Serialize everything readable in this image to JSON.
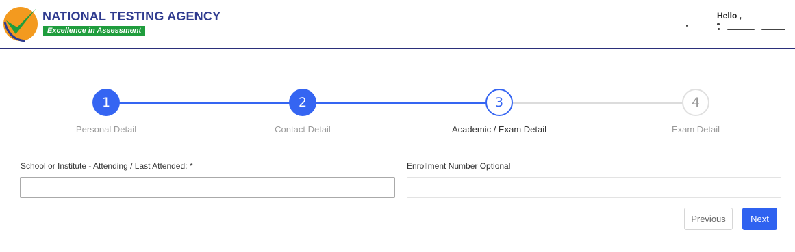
{
  "header": {
    "brand_title": "NATIONAL TESTING AGENCY",
    "brand_tagline": "Excellence in Assessment",
    "greeting": "Hello ,",
    "logo_icon": "nta-logo-checkmark-icon",
    "colors": {
      "brand_blue": "#2f3b8f",
      "brand_green": "#1f9d3d",
      "logo_orange": "#f39a1f"
    }
  },
  "stepper": {
    "steps": [
      {
        "number": "1",
        "label": "Personal Detail",
        "state": "done"
      },
      {
        "number": "2",
        "label": "Contact Detail",
        "state": "done"
      },
      {
        "number": "3",
        "label": "Academic / Exam Detail",
        "state": "active"
      },
      {
        "number": "4",
        "label": "Exam Detail",
        "state": "todo"
      }
    ],
    "accent": "#3565f2"
  },
  "form": {
    "school_label": "School or Institute - Attending / Last Attended: *",
    "school_value": "",
    "enrollment_label": "Enrollment Number Optional",
    "enrollment_value": ""
  },
  "actions": {
    "previous_label": "Previous",
    "next_label": "Next"
  }
}
